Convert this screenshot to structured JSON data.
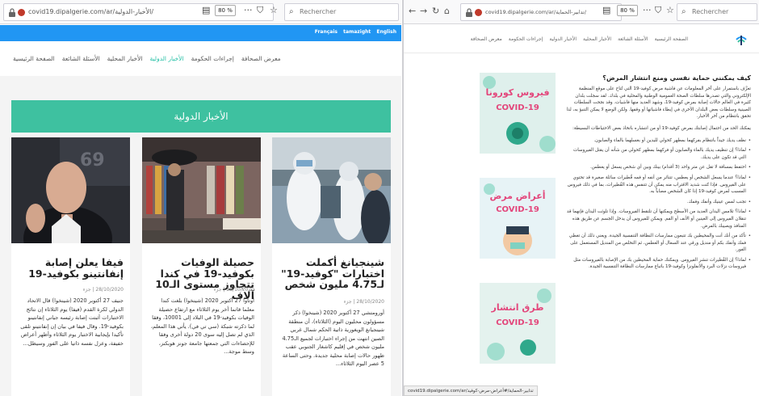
{
  "left": {
    "url": "covid19.dipalgerie.com/ar/الأخبار-الدولية/",
    "zoom": "80 %",
    "search_placeholder": "Rechercher",
    "lang_links": [
      "Français",
      "tamazight",
      "English"
    ],
    "nav_items": [
      "الصفحة الرئيسية",
      "الأسئلة الشائعة",
      "الأخبار المحلية",
      "الأخبار الدولية",
      "إجراءات الحكومة",
      "معرض الصحافة"
    ],
    "nav_active_index": 3,
    "banner": "الأخبار الدولية",
    "articles": [
      {
        "title": "شينجيانغ أكملت اختبارات \"كوفيد-19\" لـ4.75 مليون شخص",
        "date": "28/10/2020",
        "tag": "جزء",
        "excerpt": "أورومتشي 27 أكتوبر 2020 (شينخوا) ذكر مسؤولون محليون اليوم (الثلاثاء)، أن منطقة شينجيانغ الويغورية ذاتية الحكم شمال غربي الصين انتهت من إجراء اختبارات لجميع الـ4.75 مليون شخص في إقليم كاشغار الجنوبي عقب ظهور حالات إصابة محلية جديدة. وحتى الساعة 5 عصر اليوم الثلاثاء..."
      },
      {
        "title": "حصيلة الوفيات بكوفيد-19 في كندا تتجاوز مستوى الـ10 آلاف",
        "date": "28/10/2020",
        "tag": "جزء",
        "excerpt": "أوتاوا 27 أكتوبر 2020 (شينخوا) بلغت كندا معلما قاتما أخر يوم الثلاثاء مع ارتفاع حصيلة الوفيات بكوفيد-19 في البلاد إلى 10001، وفقا لما ذكرته شبكة (سي تي في). يأتي هذا المعلم، الذي لم تصل إليه سوى 20 دولة أخرى وفقا للإحصاءات التي جمعتها جامعة جونز هوبكنز، وسط موجة..."
      },
      {
        "title": "فيفا يعلن إصابة إنفانتينو بكوفيد-19",
        "date": "28/10/2020",
        "tag": "جزء",
        "excerpt": "جنيف 27 أكتوبر 2020 (شينخوا) قال الاتحاد الدولي لكرة القدم (فيفا) يوم الثلاثاء إن نتائج الاختبارات أثبتت إصابة رئيسه جياني إنفانتينو بكوفيد-19. وقال فيفا في بيان إن إنفانتينو تلقى تأكيدا بإيجابية الاختبار يوم الثلاثاء وأظهر أعراض خفيفة، وعزل نفسه ذاتيا على الفور وسيظل..."
      }
    ]
  },
  "right": {
    "url": "covid19.dipalgerie.com/ar/تدابير-الحماية/",
    "zoom": "80 %",
    "search_placeholder": "Rechercher",
    "nav_items": [
      "الصفحة الرئيسية",
      "الأسئلة الشائعة",
      "الأخبار المحلية",
      "الأخبار الدولية",
      "إجراءات الحكومة",
      "معرض الصحافة"
    ],
    "side_cards": [
      {
        "caption_ar": "فيروس كورونا",
        "caption_en": "COVID-19"
      },
      {
        "caption_ar": "أعراض مرض",
        "caption_en": "COVID-19"
      },
      {
        "caption_ar": "طرق انتشار",
        "caption_en": "COVID-19"
      }
    ],
    "article": {
      "heading": "كيف يمكنني حماية نفسي ومنع انتشار المرض؟",
      "intro": "تعرَّف باستمرار على آخر المعلومات عن فاشية مرض كوفيد-19 التي تُتاح على موقع المنظمة الإلكتروني والتي تصدرها سلطات الصحة العمومية الوطنية والمحلية في بلدك. لقد سجلت بلدان كثيرة في العالم حالات إصابة بمرض كوفيد-19، وشهد العديد منها فاشيات. وقد نجحت السلطات الصينية وسلطات بعض البلدان الأخرى في إبطاء فاشياتها أو وقفها. ولكن الوضع لا يمكن التنبؤ به، لذا تحقق بانتظام من آخر الأخبار.",
      "p2": "يمكنك الحد من احتمال إصابتك بمرض كوفيد-19 أو من انتشاره باتخاذ بعض الاحتياطات البسيطة:",
      "bullets": [
        "نظف يديك جيداً بانتظام بفركهما بمطهر كحولي لليدين أو بغسلهما بالماء والصابون.",
        "لماذا؟ إن تنظيف يديك بالماء والصابون أو فركهما بمطهر كحولي من شأنه أن يقتل الفيروسات التي قد تكون على يديك.",
        "احتفظ بمسافة لا تقل عن متر واحد (3 أقدام) بينك وبين أي شخص يسعل أو يعطس.",
        "لماذا؟ عندما يسعل الشخص أو يعطس، تتناثر من أنفه أو فمه قُطيرات سائلة صغيرة قد تحتوي على الفيروس. فإذا كنت شديد الاقتراب منه يمكن أن تتنفس هذه القُطيرات، بما في ذلك فيروس المسبب لمرض كوفيد-19 إذا كان الشخص مصاباً به.",
        "تجنب لمس عينيك وأنفك وفمك.",
        "لماذا؟ تلامس اليدان العديد من الأسطح ويمكنها أن تلتقط الفيروسات. وإذا تلوثت اليدان فإنهما قد تنقلان الفيروس إلى العينين أو الأنف أو الفم. ويمكن للفيروس أن يدخل الجسم عن طريق هذه المنافذ ويصيبك بالمرض.",
        "تأكد من أنك أنت والمحيطين بك تتبعون ممارسات النظافة التنفسية الجيدة. ويعني ذلك أن تغطي فمك وأنفك بكم أو منديل ورقي عند السعال أو العطس، ثم التخلص من المنديل المستعمل على الفور.",
        "لماذا؟ إن القُطيرات تنشر الفيروس. ويمكنك حماية المحيطين بك من الإصابة بالفيروسات مثل فيروسات نزلات البرد والأنفلونزا وكوفيد-19 باتباع ممارسات النظافة التنفسية الجيدة."
      ]
    },
    "status_url": "covid19.dipalgerie.com/ar/تدابير-الحماية/#أعراض-مرض-كوفيد"
  },
  "colors": {
    "blue_bar": "#2196f3",
    "teal": "#3ec1a0",
    "pink": "#e3467b"
  }
}
